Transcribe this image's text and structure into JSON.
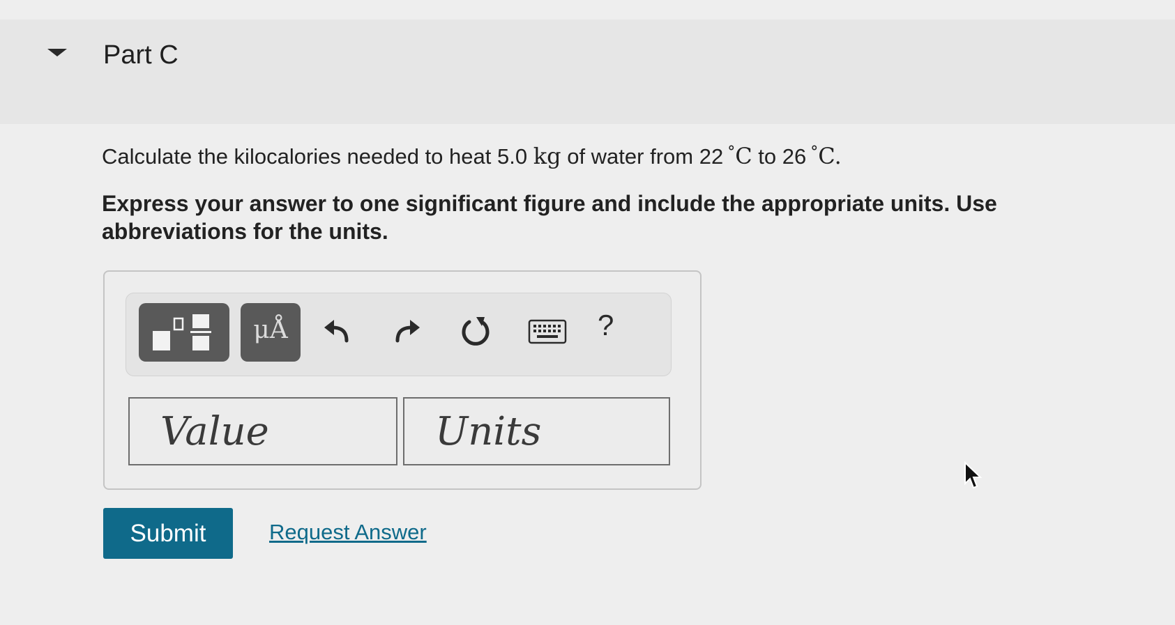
{
  "part": {
    "title": "Part C"
  },
  "question": {
    "prefix": "Calculate the kilocalories needed to heat 5.0",
    "mass_unit": "kg",
    "middle": "of water from 22",
    "temp_unit_1": "C",
    "to_word": "to 26",
    "temp_unit_2": "C",
    "suffix": ".",
    "degree_symbol": "°"
  },
  "instructions": "Express your answer to one significant figure and include the appropriate units. Use abbreviations for the units.",
  "toolbar": {
    "units_label": "μÅ",
    "help_label": "?",
    "icons": [
      "templates-icon",
      "undo-icon",
      "redo-icon",
      "reset-icon",
      "keyboard-icon",
      "help-icon"
    ]
  },
  "answer": {
    "value_placeholder": "Value",
    "units_placeholder": "Units",
    "value": "",
    "units": ""
  },
  "actions": {
    "submit_label": "Submit",
    "request_answer_label": "Request Answer"
  },
  "colors": {
    "accent": "#0f6a8a",
    "tool_button": "#595959",
    "background": "#eeeeee"
  }
}
